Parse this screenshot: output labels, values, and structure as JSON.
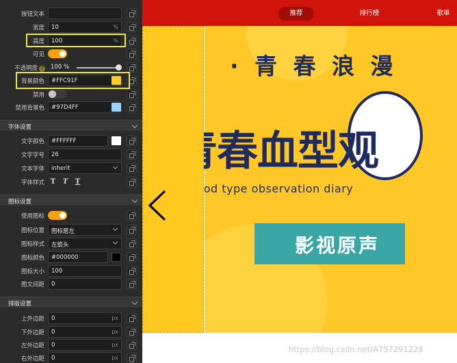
{
  "panel": {
    "style_rows": {
      "button_text": {
        "label": "按钮文本",
        "value": ""
      },
      "width": {
        "label": "宽度",
        "value": "10",
        "unit": "%"
      },
      "height": {
        "label": "高度",
        "value": "100",
        "unit": "%"
      },
      "visible": {
        "label": "可见",
        "on": true
      },
      "opacity": {
        "label": "不透明度",
        "help": "?",
        "value": "100",
        "unit": "%",
        "level_percent": 100
      },
      "bg_color": {
        "label": "背景颜色",
        "value": "#FFC91F",
        "swatch": "#FFC91F"
      },
      "disabled": {
        "label": "禁用",
        "on": false
      },
      "disabled_bg": {
        "label": "禁用背景色",
        "value": "#97D4FF",
        "swatch": "#97D4FF"
      }
    },
    "font_section": {
      "title": "字体设置",
      "text_color": {
        "label": "文字颜色",
        "value": "#FFFFFF",
        "swatch": "#FFFFFF"
      },
      "font_size": {
        "label": "文字字号",
        "value": "26"
      },
      "font_family": {
        "label": "文本字体",
        "value": "inherit"
      },
      "font_style": {
        "label": "字体样式",
        "buttons": [
          "T",
          "T",
          "T"
        ]
      }
    },
    "icon_section": {
      "title": "图标设置",
      "use_icon": {
        "label": "使用图标",
        "on": true
      },
      "icon_position": {
        "label": "图标位置",
        "value": "图标居左"
      },
      "icon_style": {
        "label": "图标样式",
        "value": "左箭头"
      },
      "icon_color": {
        "label": "图标颜色",
        "value": "#000000",
        "swatch": "#000000"
      },
      "icon_size": {
        "label": "图标大小",
        "value": "100"
      },
      "icon_gap": {
        "label": "图文间距",
        "value": "0"
      }
    },
    "layout_section": {
      "title": "排版设置",
      "margin_top": {
        "label": "上外边距",
        "value": "0",
        "unit": "px"
      },
      "margin_bottom": {
        "label": "下外边距",
        "value": "0",
        "unit": "px"
      },
      "margin_left": {
        "label": "左外边距",
        "value": "0",
        "unit": "px"
      },
      "margin_right": {
        "label": "右外边距",
        "value": "0",
        "unit": "px"
      }
    }
  },
  "canvas": {
    "nav": [
      {
        "label": "推荐",
        "active": true
      },
      {
        "label": "排行榜",
        "active": false
      },
      {
        "label": "歌单",
        "active": false
      }
    ],
    "banner": {
      "slogan": "· 青 春 浪 漫",
      "big_title": "青春血型观",
      "subtitle_en": "Blood type observation diary",
      "bar_text": "影视原声"
    },
    "watermark": "https://blog.csdn.net/A757291228"
  },
  "colors": {
    "accent_orange": "#f5a20f",
    "nav_red": "#d0140b",
    "banner_yellow": "#ffc826",
    "highlight_yellow": "#f3e64a"
  }
}
